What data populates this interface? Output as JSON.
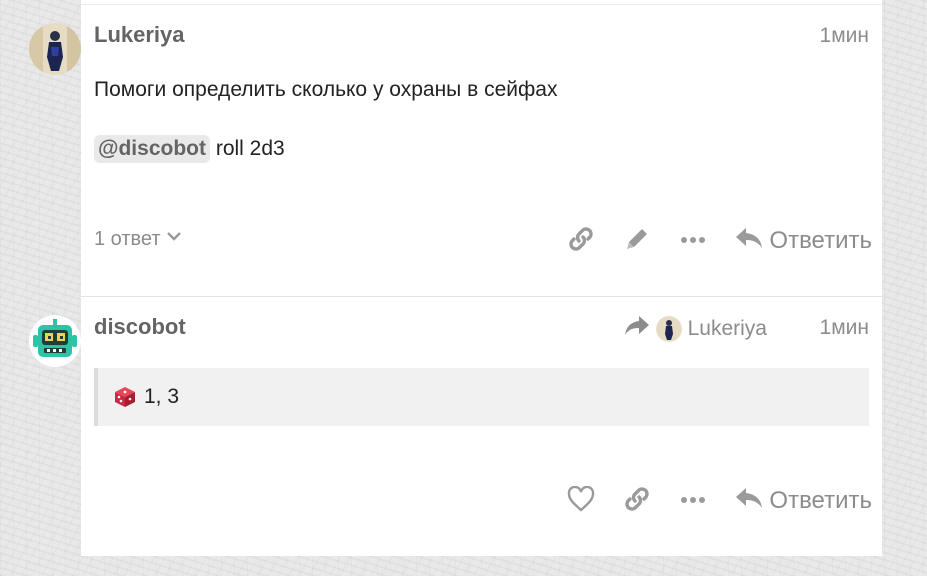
{
  "posts": [
    {
      "username": "Lukeriya",
      "date": "1мин",
      "body_line1": "Помоги определить сколько у охраны в сейфах",
      "mention": "@discobot",
      "command": "roll 2d3",
      "replies_label": "1 ответ",
      "reply_label": "Ответить"
    },
    {
      "username": "discobot",
      "date": "1мин",
      "reply_to_user": "Lukeriya",
      "result": "1, 3",
      "reply_label": "Ответить"
    }
  ],
  "colors": {
    "username": "#646464",
    "muted": "#8c8c8c",
    "quote_bg": "#f1f1f1",
    "discobot_avatar": "#2dc4a6"
  },
  "icons": [
    "link-icon",
    "pencil-icon",
    "ellipsis-icon",
    "reply-arrow-icon",
    "heart-icon",
    "share-arrow-icon",
    "dice-icon",
    "chevron-down-icon"
  ]
}
